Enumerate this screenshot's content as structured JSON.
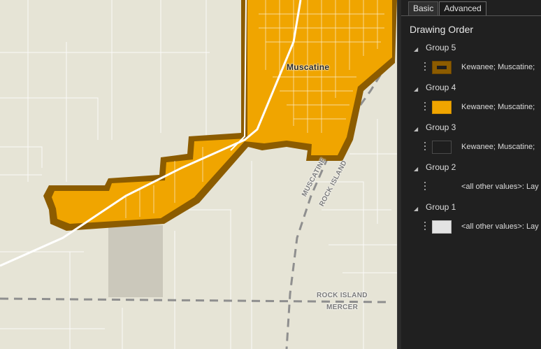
{
  "map": {
    "city_label": "Muscatine",
    "boundary_label_1": "MUSCATINE",
    "boundary_label_2": "ROCK ISLAND",
    "boundary_label_3": "ROCK ISLAND",
    "boundary_label_4": "MERCER",
    "colors": {
      "land": "#e6e4d6",
      "fill": "#f0a500",
      "outline": "#8c5c00",
      "road": "#ffffff",
      "boundary": "#8f8f8f"
    }
  },
  "panel": {
    "tabs": [
      {
        "label": "Basic"
      },
      {
        "label": "Advanced"
      }
    ],
    "active_tab": "Advanced",
    "heading": "Drawing Order",
    "groups": [
      {
        "label": "Group 5",
        "symbol_text": "Kewanee; Muscatine;",
        "swatch": "outline-fill",
        "swatch_color": "#8c5c00"
      },
      {
        "label": "Group 4",
        "symbol_text": "Kewanee; Muscatine;",
        "swatch": "solid",
        "swatch_color": "#f0a500"
      },
      {
        "label": "Group 3",
        "symbol_text": "Kewanee; Muscatine;",
        "swatch": "empty",
        "swatch_color": "#1e1e1e"
      },
      {
        "label": "Group 2",
        "symbol_text": "<all other values>: Lay",
        "swatch": "none",
        "swatch_color": ""
      },
      {
        "label": "Group 1",
        "symbol_text": "<all other values>: Lay",
        "swatch": "light",
        "swatch_color": "#e3e3e3"
      }
    ]
  }
}
